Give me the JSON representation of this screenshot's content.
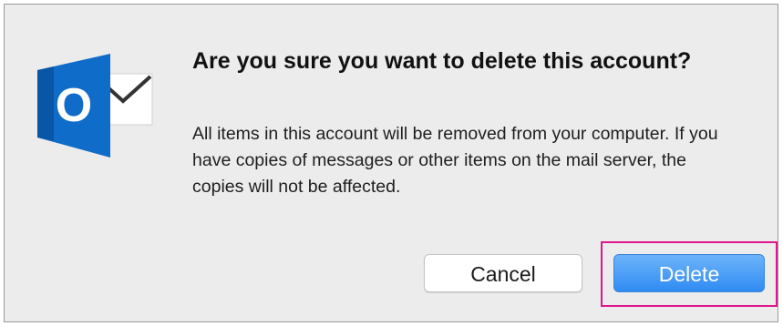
{
  "dialog": {
    "title": "Are you sure you want to delete this account?",
    "message": "All items in this account will be removed from your computer. If you have copies of messages or other items on the mail server, the copies will not be affected.",
    "icon": "outlook-app-icon",
    "icon_letter": "O"
  },
  "buttons": {
    "cancel_label": "Cancel",
    "delete_label": "Delete"
  },
  "colors": {
    "primary_button": "#3d93f5",
    "highlight": "#e0178c",
    "outlook_blue": "#0f6cc8"
  }
}
